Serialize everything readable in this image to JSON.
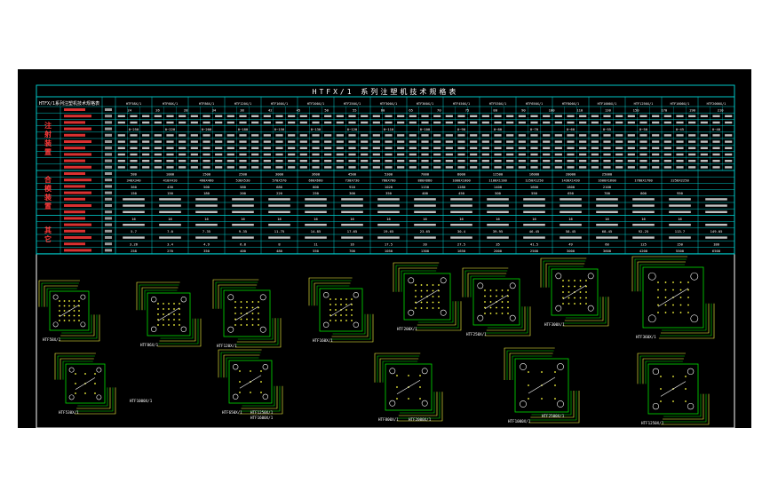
{
  "title": "HTFX/1 系列注塑机技术规格表",
  "subtitle": "HTFX/1系列注塑机技术规格表",
  "sections": [
    "注射装置",
    "合模装置",
    "其它"
  ],
  "models": [
    "HTF58X/1",
    "HTF60X/1",
    "HTF86X/1",
    "HTF120X/1",
    "HTF160X/1",
    "HTF200X/1",
    "HTF250X/1",
    "HTF300X/1",
    "HTF360X/1",
    "HTF450X/1",
    "HTF530X/1",
    "HTF650X/1",
    "HTF800X/1",
    "HTF1000X/1",
    "HTF1250X/1",
    "HTF1600X/1",
    "HTF2000X/1"
  ],
  "sample_values": [
    [
      "24",
      "26",
      "28",
      "34",
      "38",
      "42",
      "45",
      "50",
      "55",
      "60",
      "65",
      "70",
      "75",
      "80",
      "90",
      "100",
      "110",
      "130",
      "150",
      "170",
      "190",
      "210"
    ],
    [
      "0~250",
      "0~220",
      "0~200",
      "0~180",
      "0~150",
      "0~130",
      "0~120",
      "0~110",
      "0~100",
      "0~90",
      "0~80",
      "0~70",
      "0~60",
      "0~55",
      "0~50",
      "0~45",
      "0~40"
    ],
    [
      "580",
      "1000",
      "1500",
      "2500",
      "3000",
      "3600",
      "4500",
      "5300",
      "7000",
      "8000",
      "12500",
      "16000",
      "20000",
      "25000"
    ],
    [
      "340X340",
      "410X410",
      "460X460",
      "530X530",
      "570X570",
      "660X660",
      "730X730",
      "780X780",
      "880X880",
      "1000X1000",
      "1100X1100",
      "1250X1250",
      "1430X1430",
      "1600X1600",
      "1780X1780",
      "2250X2250"
    ],
    [
      "360",
      "430",
      "500",
      "580",
      "680",
      "800",
      "910",
      "1020",
      "1150",
      "1280",
      "1400",
      "1600",
      "1800",
      "2100"
    ],
    [
      "150",
      "150",
      "180",
      "200",
      "220",
      "250",
      "300",
      "350",
      "400",
      "450",
      "500",
      "550",
      "650",
      "700",
      "800",
      "950"
    ],
    [
      "16",
      "16",
      "16",
      "16",
      "16",
      "16",
      "16",
      "16",
      "16",
      "16",
      "16",
      "16",
      "16",
      "16",
      "16",
      "16"
    ],
    [
      "5.7",
      "7.0",
      "7.35",
      "9.35",
      "11.75",
      "14.85",
      "17.65",
      "19.65",
      "23.65",
      "30.4",
      "39.95",
      "46.45",
      "58.45",
      "68.45",
      "92.25",
      "113.7",
      "149.05"
    ],
    [
      "3.26",
      "3.4",
      "4.9",
      "6.8",
      "8",
      "11",
      "16",
      "17.5",
      "20",
      "27.5",
      "35",
      "41.5",
      "49",
      "60",
      "125",
      "150",
      "180"
    ],
    [
      "258",
      "270",
      "350",
      "400",
      "480",
      "550",
      "700",
      "1050",
      "1300",
      "1650",
      "2000",
      "2500",
      "3000",
      "3600",
      "4200",
      "5500",
      "6500"
    ]
  ],
  "drawing_labels": [
    "HTF58X/1",
    "HTF86X/1",
    "HTF120X/1",
    "HTF160X/1",
    "HTF200X/1",
    "HTF250X/1",
    "HTF300X/1",
    "HTF360X/1",
    "HTF530X/1",
    "HTF650X/1",
    "HTF800X/1",
    "HTF1000X/1",
    "HTF1250X/1",
    "HTF1600X/1",
    "HTF2000X/1",
    "HTF2500X/1"
  ],
  "colors": {
    "background": "#000000",
    "border": "#ffffff",
    "grid": "#00c8c8",
    "section_label": "#ff3a3a",
    "row_label": "#ff3a3a",
    "cell_text": "#ffffff",
    "drawing": "#00e000",
    "drawing_accent": "#ffff40"
  }
}
